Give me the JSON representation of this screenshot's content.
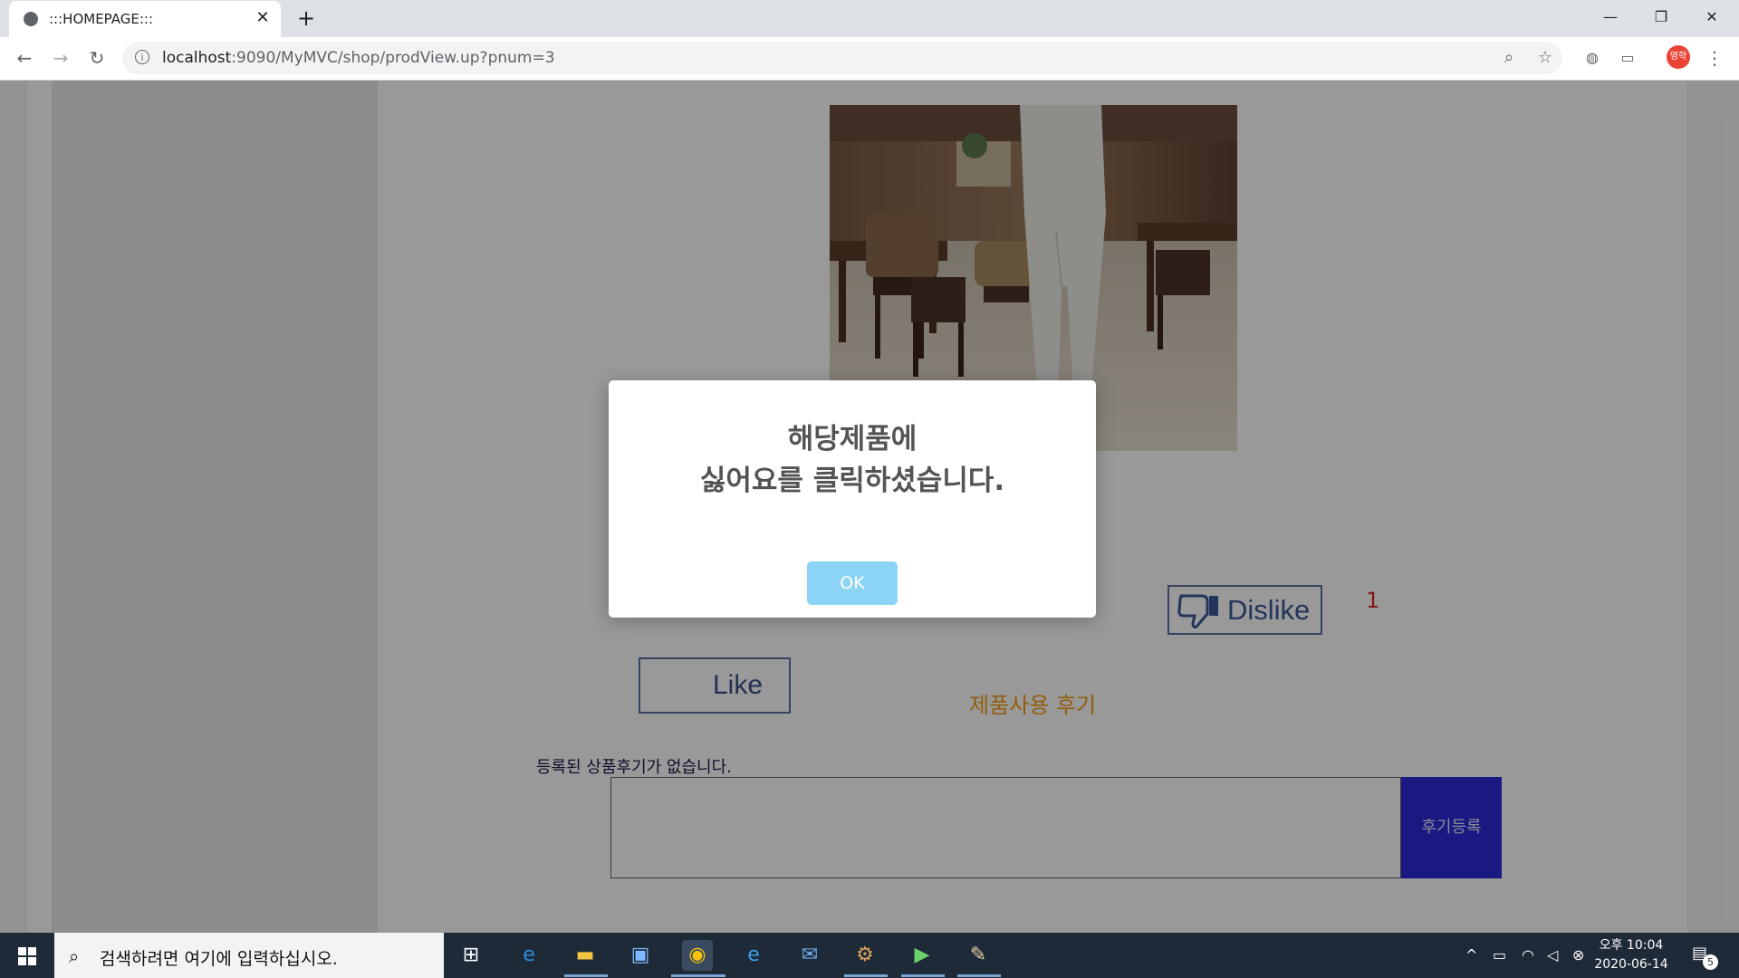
{
  "browser": {
    "tab_title": ":::HOMEPAGE:::",
    "url_host": "localhost",
    "url_rest": ":9090/MyMVC/shop/prodView.up?pnum=3",
    "profile_label": "영학"
  },
  "page": {
    "like_label": "Like",
    "dislike_label": "Dislike",
    "dislike_count": "1",
    "review_section_title": "제품사용 후기",
    "no_review_text": "등록된 상품후기가 없습니다.",
    "review_submit_label": "후기등록"
  },
  "modal": {
    "line1": "해당제품에",
    "line2": "싫어요를 클릭하셨습니다.",
    "ok_label": "OK"
  },
  "taskbar": {
    "search_placeholder": "검색하려면 여기에 입력하십시오.",
    "time": "오후 10:04",
    "date": "2020-06-14",
    "notification_count": "5"
  },
  "colors": {
    "dislike_count": "#e02424",
    "review_title": "#f39c12",
    "submit_button": "#2b2bd8",
    "ok_button": "#8cd4f5"
  }
}
